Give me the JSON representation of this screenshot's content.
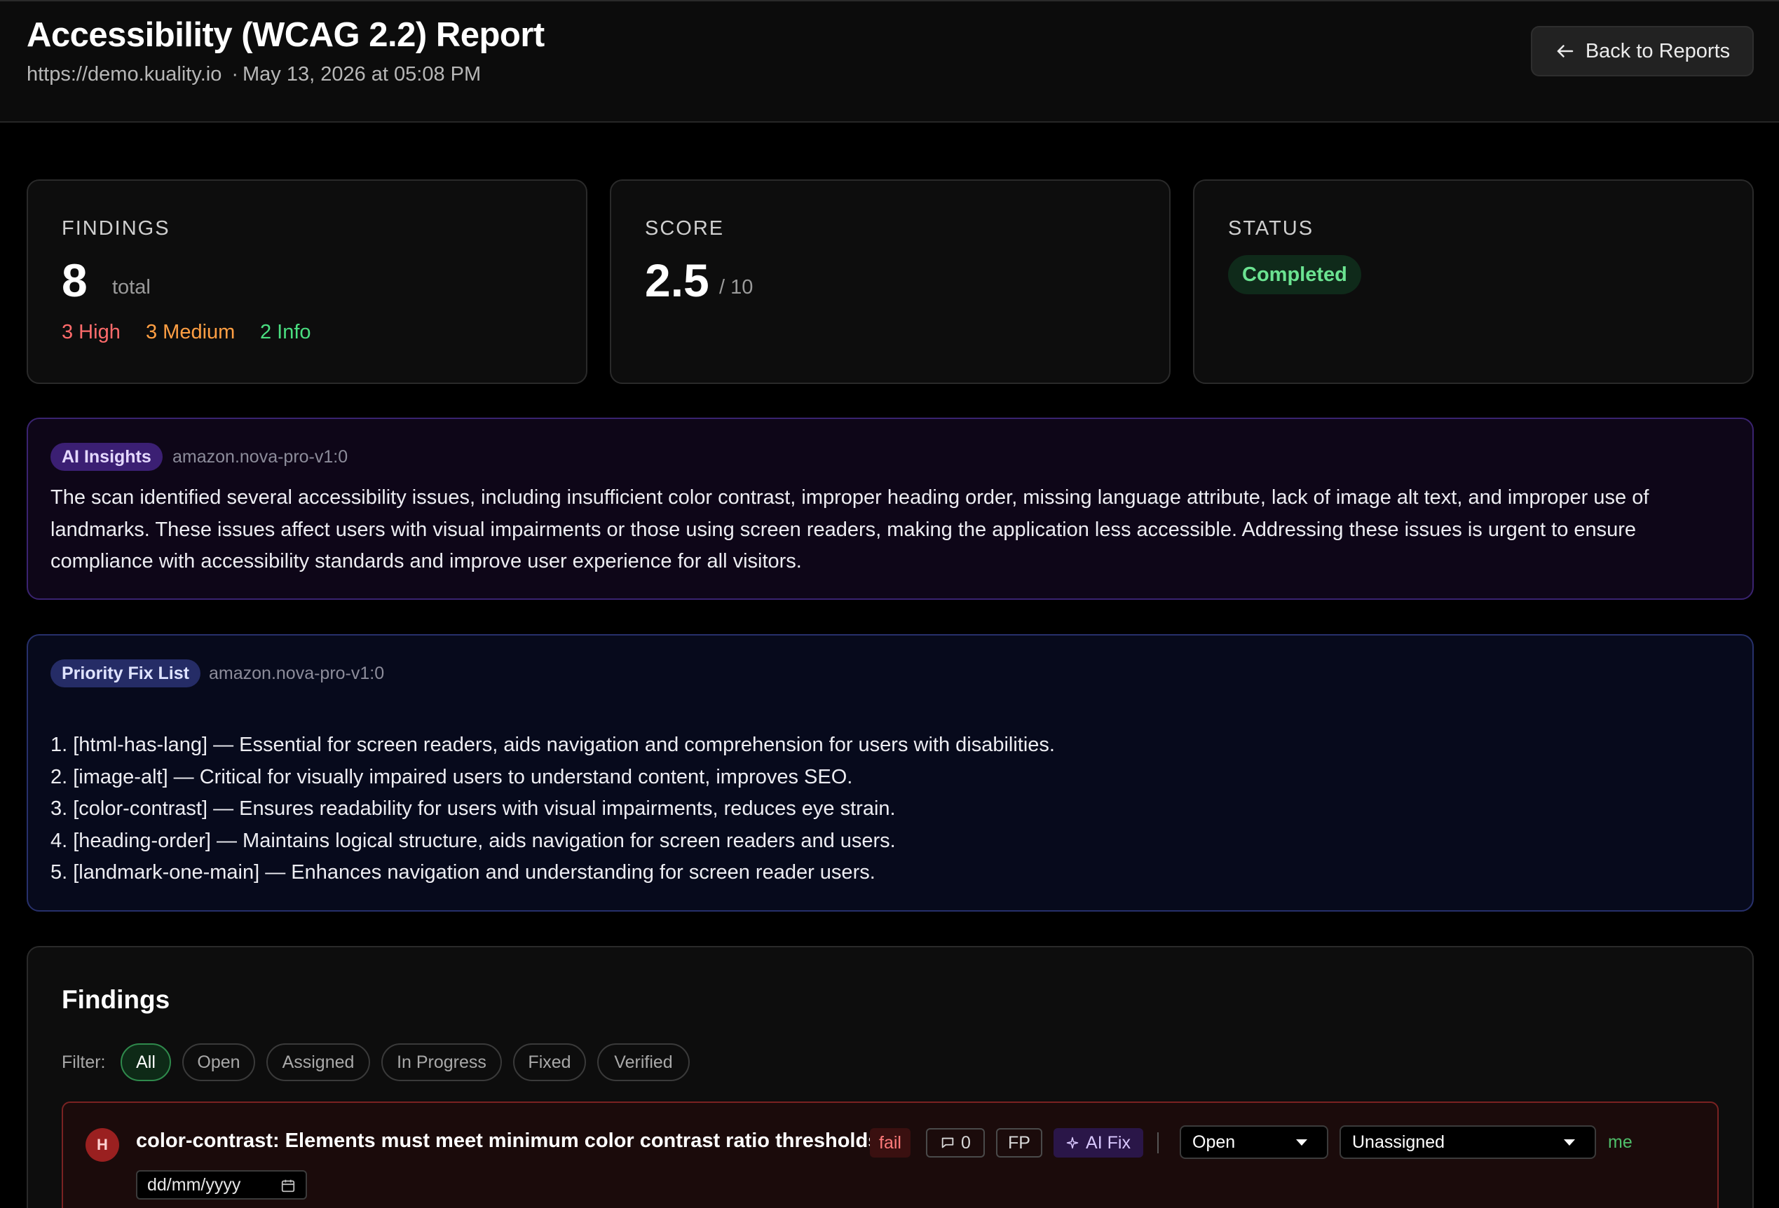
{
  "header": {
    "title": "Accessibility (WCAG 2.2) Report",
    "url": "https://demo.kuality.io",
    "separator": "·",
    "timestamp": "May 13, 2026 at 05:08 PM",
    "back_label": "Back to Reports",
    "back_icon": "arrow-left-icon"
  },
  "stats": {
    "findings": {
      "label": "FINDINGS",
      "total": "8",
      "total_suffix": "total",
      "high": "3 High",
      "medium": "3 Medium",
      "info": "2 Info"
    },
    "score": {
      "label": "SCORE",
      "value": "2.5",
      "suffix": "/ 10"
    },
    "status": {
      "label": "STATUS",
      "value": "Completed"
    }
  },
  "ai_insights": {
    "badge": "AI Insights",
    "model": "amazon.nova-pro-v1:0",
    "text": "The scan identified several accessibility issues, including insufficient color contrast, improper heading order, missing language attribute, lack of image alt text, and improper use of landmarks. These issues affect users with visual impairments or those using screen readers, making the application less accessible. Addressing these issues is urgent to ensure compliance with accessibility standards and improve user experience for all visitors."
  },
  "priority_fix_list": {
    "badge": "Priority Fix List",
    "model": "amazon.nova-pro-v1:0",
    "items": [
      "1. [html-has-lang] — Essential for screen readers, aids navigation and comprehension for users with disabilities.",
      "2. [image-alt] — Critical for visually impaired users to understand content, improves SEO.",
      "3. [color-contrast] — Ensures readability for users with visual impairments, reduces eye strain.",
      "4. [heading-order] — Maintains logical structure, aids navigation for screen readers and users.",
      "5. [landmark-one-main] — Enhances navigation and understanding for screen reader users."
    ]
  },
  "findings": {
    "title": "Findings",
    "filter_label": "Filter:",
    "filters": [
      "All",
      "Open",
      "Assigned",
      "In Progress",
      "Fixed",
      "Verified"
    ],
    "active_filter": "All",
    "rows": [
      {
        "severity_letter": "H",
        "title": "color-contrast: Elements must meet minimum color contrast ratio thresholds",
        "result": "fail",
        "comments": "0",
        "fp_label": "FP",
        "ai_fix_label": "AI Fix",
        "status": "Open",
        "assignee": "Unassigned",
        "assign_me": "me",
        "date_placeholder": "dd/mm/yyyy"
      }
    ]
  },
  "colors": {
    "high": "#ff6b6b",
    "medium": "#ff9f43",
    "info": "#4ade80",
    "completed": "#6be391",
    "ai_border": "#3a2370",
    "pfl_border": "#27306b",
    "finding_border": "#7a2222"
  }
}
